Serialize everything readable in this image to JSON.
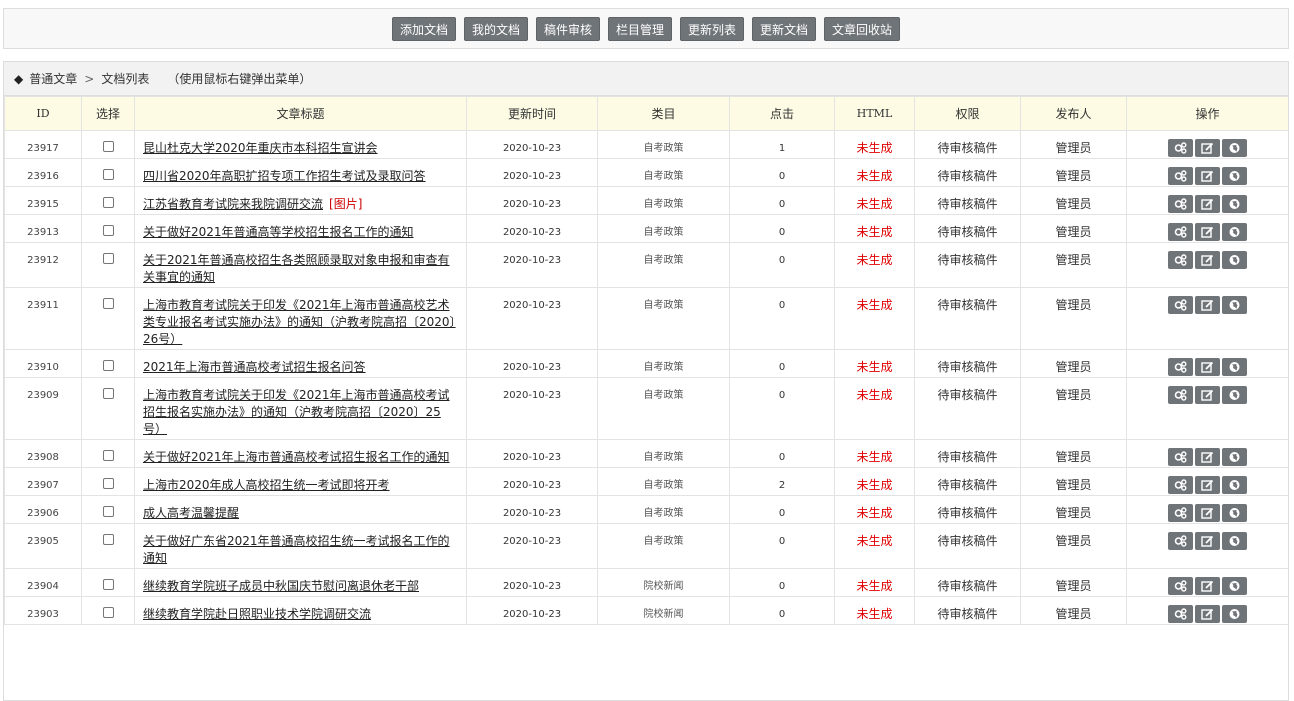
{
  "toolbar": {
    "buttons": [
      "添加文档",
      "我的文档",
      "稿件审核",
      "栏目管理",
      "更新列表",
      "更新文档",
      "文章回收站"
    ]
  },
  "breadcrumb": {
    "root": "普通文章",
    "sep": ">",
    "current": "文档列表",
    "hint": "（使用鼠标右键弹出菜单）"
  },
  "table": {
    "headers": [
      "ID",
      "选择",
      "文章标题",
      "更新时间",
      "类目",
      "点击",
      "HTML",
      "权限",
      "发布人",
      "操作"
    ],
    "rows": [
      {
        "id": "23917",
        "title": "昆山杜克大学2020年重庆市本科招生宣讲会",
        "tag": "",
        "date": "2020-10-23",
        "cat": "自考政策",
        "clicks": "1",
        "html": "未生成",
        "perm": "待审核稿件",
        "pub": "管理员"
      },
      {
        "id": "23916",
        "title": "四川省2020年高职扩招专项工作招生考试及录取问答",
        "tag": "",
        "date": "2020-10-23",
        "cat": "自考政策",
        "clicks": "0",
        "html": "未生成",
        "perm": "待审核稿件",
        "pub": "管理员"
      },
      {
        "id": "23915",
        "title": "江苏省教育考试院来我院调研交流",
        "tag": "[图片]",
        "date": "2020-10-23",
        "cat": "自考政策",
        "clicks": "0",
        "html": "未生成",
        "perm": "待审核稿件",
        "pub": "管理员"
      },
      {
        "id": "23913",
        "title": "关于做好2021年普通高等学校招生报名工作的通知",
        "tag": "",
        "date": "2020-10-23",
        "cat": "自考政策",
        "clicks": "0",
        "html": "未生成",
        "perm": "待审核稿件",
        "pub": "管理员"
      },
      {
        "id": "23912",
        "title": "关于2021年普通高校招生各类照顾录取对象申报和审查有关事宜的通知",
        "tag": "",
        "date": "2020-10-23",
        "cat": "自考政策",
        "clicks": "0",
        "html": "未生成",
        "perm": "待审核稿件",
        "pub": "管理员"
      },
      {
        "id": "23911",
        "title": "上海市教育考试院关于印发《2021年上海市普通高校艺术类专业报名考试实施办法》的通知（沪教考院高招〔2020〕26号）",
        "tag": "",
        "date": "2020-10-23",
        "cat": "自考政策",
        "clicks": "0",
        "html": "未生成",
        "perm": "待审核稿件",
        "pub": "管理员"
      },
      {
        "id": "23910",
        "title": "2021年上海市普通高校考试招生报名问答",
        "tag": "",
        "date": "2020-10-23",
        "cat": "自考政策",
        "clicks": "0",
        "html": "未生成",
        "perm": "待审核稿件",
        "pub": "管理员"
      },
      {
        "id": "23909",
        "title": "上海市教育考试院关于印发《2021年上海市普通高校考试招生报名实施办法》的通知（沪教考院高招〔2020〕25号）",
        "tag": "",
        "date": "2020-10-23",
        "cat": "自考政策",
        "clicks": "0",
        "html": "未生成",
        "perm": "待审核稿件",
        "pub": "管理员"
      },
      {
        "id": "23908",
        "title": "关于做好2021年上海市普通高校考试招生报名工作的通知",
        "tag": "",
        "date": "2020-10-23",
        "cat": "自考政策",
        "clicks": "0",
        "html": "未生成",
        "perm": "待审核稿件",
        "pub": "管理员"
      },
      {
        "id": "23907",
        "title": "上海市2020年成人高校招生统一考试即将开考",
        "tag": "",
        "date": "2020-10-23",
        "cat": "自考政策",
        "clicks": "2",
        "html": "未生成",
        "perm": "待审核稿件",
        "pub": "管理员"
      },
      {
        "id": "23906",
        "title": "成人高考温馨提醒",
        "tag": "",
        "date": "2020-10-23",
        "cat": "自考政策",
        "clicks": "0",
        "html": "未生成",
        "perm": "待审核稿件",
        "pub": "管理员"
      },
      {
        "id": "23905",
        "title": "关于做好广东省2021年普通高校招生统一考试报名工作的通知",
        "tag": "",
        "date": "2020-10-23",
        "cat": "自考政策",
        "clicks": "0",
        "html": "未生成",
        "perm": "待审核稿件",
        "pub": "管理员"
      },
      {
        "id": "23904",
        "title": "继续教育学院班子成员中秋国庆节慰问离退休老干部",
        "tag": "",
        "date": "2020-10-23",
        "cat": "院校新闻",
        "clicks": "0",
        "html": "未生成",
        "perm": "待审核稿件",
        "pub": "管理员"
      },
      {
        "id": "23903",
        "title": "继续教育学院赴日照职业技术学院调研交流",
        "tag": "",
        "date": "2020-10-23",
        "cat": "院校新闻",
        "clicks": "0",
        "html": "未生成",
        "perm": "待审核稿件",
        "pub": "管理员"
      }
    ],
    "row_ops": [
      "settings-icon",
      "edit-icon",
      "preview-icon"
    ]
  },
  "colors": {
    "button_bg": "#6f7478",
    "header_bg": "#fdfbe4",
    "html_status": "#e00000",
    "tag": "#cc0000"
  }
}
